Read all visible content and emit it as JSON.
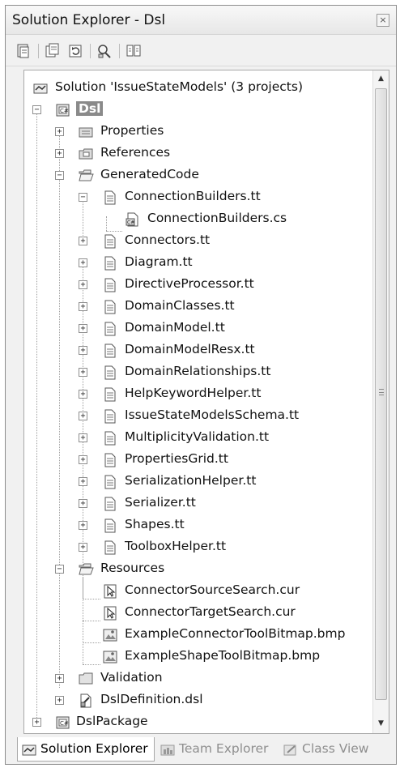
{
  "window": {
    "title": "Solution Explorer - Dsl",
    "close_glyph": "×"
  },
  "toolbar": {
    "buttons": [
      {
        "name": "properties-icon"
      },
      {
        "name": "show-all-files-icon"
      },
      {
        "name": "refresh-icon"
      },
      {
        "name": "view-class-diagram-icon"
      },
      {
        "name": "transform-templates-icon"
      }
    ]
  },
  "tree": {
    "expand_glyph": "+",
    "collapse_glyph": "−",
    "solution": "Solution 'IssueStateModels' (3 projects)",
    "project_dsl": "Dsl",
    "properties": "Properties",
    "references": "References",
    "generated_code": "GeneratedCode",
    "connection_builders_tt": "ConnectionBuilders.tt",
    "connection_builders_cs": "ConnectionBuilders.cs",
    "generated_files": [
      "Connectors.tt",
      "Diagram.tt",
      "DirectiveProcessor.tt",
      "DomainClasses.tt",
      "DomainModel.tt",
      "DomainModelResx.tt",
      "DomainRelationships.tt",
      "HelpKeywordHelper.tt",
      "IssueStateModelsSchema.tt",
      "MultiplicityValidation.tt",
      "PropertiesGrid.tt",
      "SerializationHelper.tt",
      "Serializer.tt",
      "Shapes.tt",
      "ToolboxHelper.tt"
    ],
    "resources": "Resources",
    "resource_files": [
      {
        "label": "ConnectorSourceSearch.cur",
        "icon": "cursor-file-icon"
      },
      {
        "label": "ConnectorTargetSearch.cur",
        "icon": "cursor-file-icon"
      },
      {
        "label": "ExampleConnectorToolBitmap.bmp",
        "icon": "bitmap-file-icon"
      },
      {
        "label": "ExampleShapeToolBitmap.bmp",
        "icon": "bitmap-file-icon"
      }
    ],
    "validation": "Validation",
    "dsl_definition": "DslDefinition.dsl",
    "project_dsl_package": "DslPackage"
  },
  "scrollbar": {
    "up_glyph": "▲",
    "down_glyph": "▼"
  },
  "tabs": [
    {
      "label": "Solution Explorer",
      "active": true
    },
    {
      "label": "Team Explorer",
      "active": false
    },
    {
      "label": "Class View",
      "active": false
    }
  ],
  "colors": {
    "selection": "#8a8a8a",
    "folder": "#d9d9d9",
    "file": "#f2f2f2"
  }
}
